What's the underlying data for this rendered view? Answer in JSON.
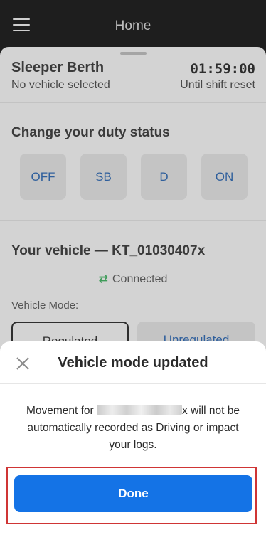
{
  "header": {
    "title": "Home"
  },
  "status": {
    "label": "Sleeper Berth",
    "vehicle_selected": "No vehicle selected",
    "timer": "01:59:00",
    "timer_caption": "Until shift reset"
  },
  "duty": {
    "heading": "Change your duty status",
    "buttons": [
      "OFF",
      "SB",
      "D",
      "ON"
    ]
  },
  "vehicle": {
    "heading": "Your vehicle — KT_01030407x",
    "connection": "Connected",
    "mode_label": "Vehicle Mode:",
    "modes": [
      "Regulated",
      "Unregulated"
    ]
  },
  "modal": {
    "title": "Vehicle mode updated",
    "message_prefix": "Movement for",
    "message_vehicle_suffix": "x",
    "message_suffix": "will not be automatically recorded as Driving or impact your logs.",
    "done_label": "Done"
  },
  "colors": {
    "primary": "#1473e6",
    "highlight": "#cf3535",
    "connected": "#3f9c5a"
  }
}
